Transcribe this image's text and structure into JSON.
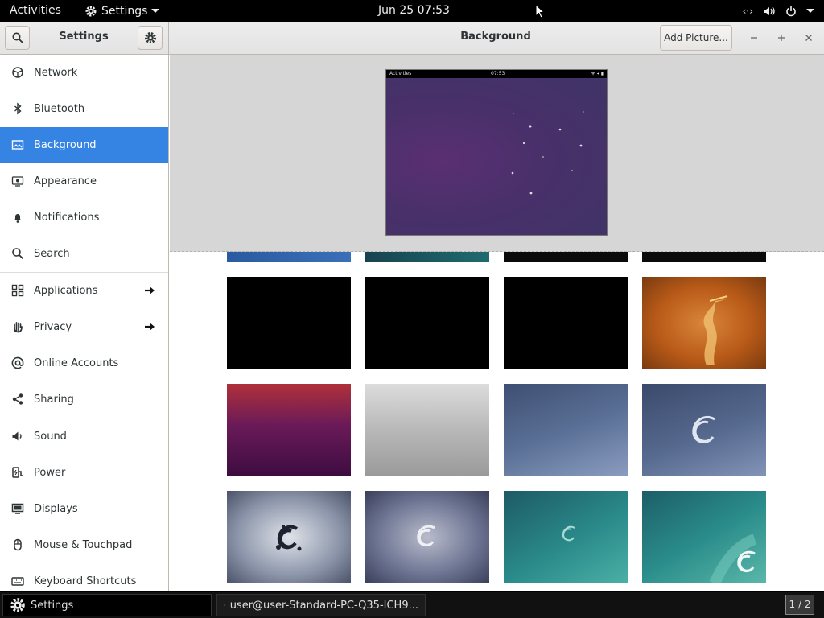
{
  "topbar": {
    "activities": "Activities",
    "app_menu": "Settings",
    "clock": "Jun 25  07:53"
  },
  "headerbar": {
    "sidebar_title": "Settings",
    "page_title": "Background",
    "add_picture": "Add Picture..."
  },
  "sidebar": {
    "items": [
      {
        "label": "Network",
        "icon": "network-icon"
      },
      {
        "label": "Bluetooth",
        "icon": "bluetooth-icon"
      },
      {
        "label": "Background",
        "icon": "background-icon"
      },
      {
        "label": "Appearance",
        "icon": "appearance-icon"
      },
      {
        "label": "Notifications",
        "icon": "bell-icon"
      },
      {
        "label": "Search",
        "icon": "search-icon"
      },
      {
        "label": "Applications",
        "icon": "grid-icon"
      },
      {
        "label": "Privacy",
        "icon": "hand-icon"
      },
      {
        "label": "Online Accounts",
        "icon": "at-icon"
      },
      {
        "label": "Sharing",
        "icon": "share-icon"
      },
      {
        "label": "Sound",
        "icon": "speaker-icon"
      },
      {
        "label": "Power",
        "icon": "power-plug-icon"
      },
      {
        "label": "Displays",
        "icon": "display-icon"
      },
      {
        "label": "Mouse & Touchpad",
        "icon": "mouse-icon"
      },
      {
        "label": "Keyboard Shortcuts",
        "icon": "keyboard-icon"
      }
    ],
    "active": "Background"
  },
  "preview": {
    "bar_left": "Activities",
    "bar_clock": "07:53"
  },
  "taskbar": {
    "settings": "Settings",
    "terminal": "user@user-Standard-PC-Q35-ICH9...",
    "pager": "1 / 2"
  },
  "colors": {
    "accent": "#3584e4",
    "topbar": "#000000"
  }
}
